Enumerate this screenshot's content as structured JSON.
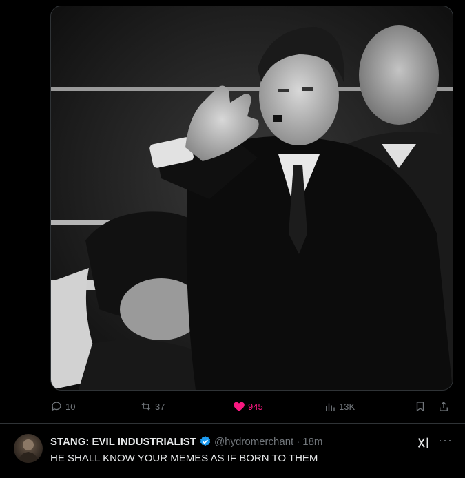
{
  "post": {
    "media_alt": "",
    "actions": {
      "replies": "10",
      "reposts": "37",
      "likes": "945",
      "views": "13K"
    }
  },
  "reply": {
    "display_name": "STANG: EVIL INDUSTRIALIST",
    "handle": "@hydromerchant",
    "separator": "·",
    "time": "18m",
    "text": "HE SHALL KNOW YOUR MEMES AS IF BORN TO THEM",
    "more_label": "···"
  },
  "colors": {
    "background": "#000000",
    "text": "#e7e9ea",
    "muted": "#71767b",
    "like": "#f91880",
    "verified": "#1d9bf0",
    "border": "#2f3336"
  },
  "icons": {
    "reply": "reply-bubble-icon",
    "repost": "repost-icon",
    "like": "heart-icon",
    "views": "bar-chart-icon",
    "bookmark": "bookmark-icon",
    "share": "share-icon",
    "verified": "verified-badge-icon",
    "grok": "grok-icon",
    "more": "more-icon"
  }
}
